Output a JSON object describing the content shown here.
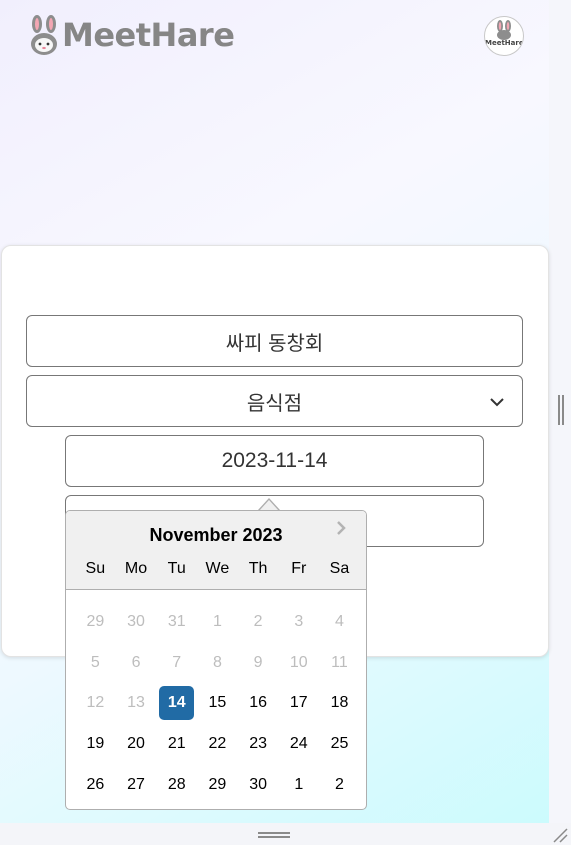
{
  "app": {
    "logo_text": "MeetHare",
    "avatar_text": "MeetHare"
  },
  "form": {
    "name_value": "싸피 동창회",
    "category_value": "음식점",
    "date_value": "2023-11-14",
    "time_value": ""
  },
  "datepicker": {
    "month_label": "November 2023",
    "weekdays": [
      "Su",
      "Mo",
      "Tu",
      "We",
      "Th",
      "Fr",
      "Sa"
    ],
    "weeks": [
      [
        {
          "d": "29",
          "out": true
        },
        {
          "d": "30",
          "out": true
        },
        {
          "d": "31",
          "out": true
        },
        {
          "d": "1",
          "out": true
        },
        {
          "d": "2",
          "out": true
        },
        {
          "d": "3",
          "out": true
        },
        {
          "d": "4",
          "out": true
        }
      ],
      [
        {
          "d": "5",
          "out": true
        },
        {
          "d": "6",
          "out": true
        },
        {
          "d": "7",
          "out": true
        },
        {
          "d": "8",
          "out": true
        },
        {
          "d": "9",
          "out": true
        },
        {
          "d": "10",
          "out": true
        },
        {
          "d": "11",
          "out": true
        }
      ],
      [
        {
          "d": "12",
          "out": true
        },
        {
          "d": "13",
          "out": true
        },
        {
          "d": "14",
          "sel": true
        },
        {
          "d": "15"
        },
        {
          "d": "16"
        },
        {
          "d": "17"
        },
        {
          "d": "18"
        }
      ],
      [
        {
          "d": "19"
        },
        {
          "d": "20"
        },
        {
          "d": "21"
        },
        {
          "d": "22"
        },
        {
          "d": "23"
        },
        {
          "d": "24"
        },
        {
          "d": "25"
        }
      ],
      [
        {
          "d": "26"
        },
        {
          "d": "27"
        },
        {
          "d": "28"
        },
        {
          "d": "29"
        },
        {
          "d": "30"
        },
        {
          "d": "1"
        },
        {
          "d": "2"
        }
      ]
    ],
    "selected_color": "#216ba5"
  },
  "icons": {
    "logo": "rabbit-icon",
    "category_dropdown": "chevron-down-icon",
    "next_month": "chevron-right-icon"
  },
  "colors": {
    "logo_text": "#868686",
    "accent": "#216ba5",
    "disabled_day": "#bdbdbd"
  }
}
